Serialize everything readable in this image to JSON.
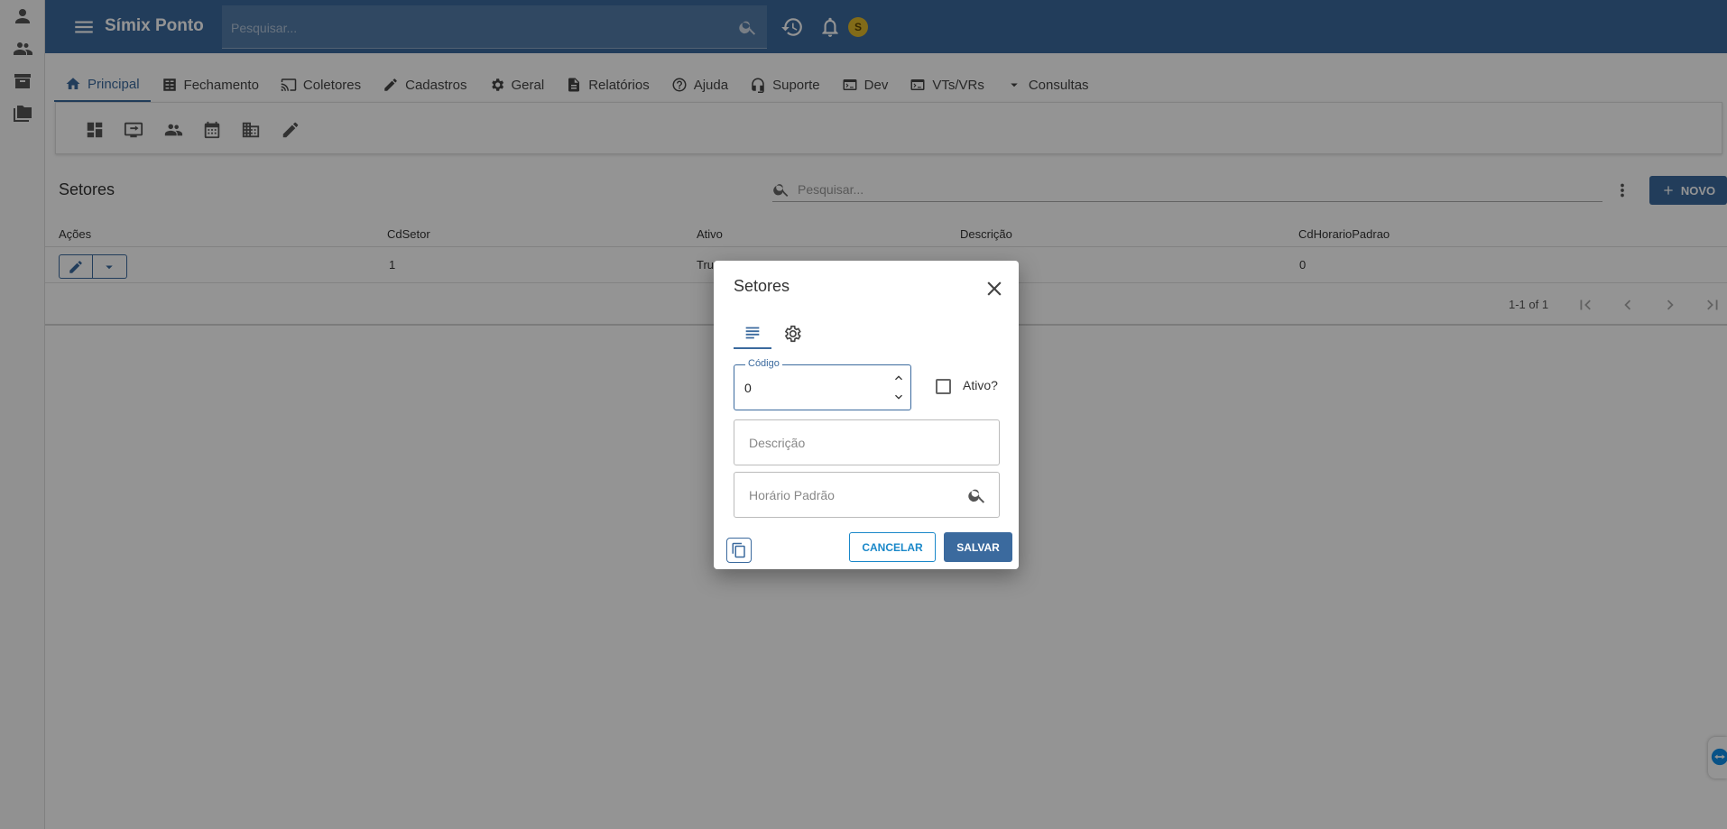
{
  "app": {
    "title": "Símix Ponto",
    "search_placeholder": "Pesquisar...",
    "avatar_initial": "S"
  },
  "nav_tabs": [
    {
      "label": "Principal",
      "icon": "home-icon",
      "active": true
    },
    {
      "label": "Fechamento",
      "icon": "calculator-icon"
    },
    {
      "label": "Coletores",
      "icon": "cast-icon"
    },
    {
      "label": "Cadastros",
      "icon": "pencil-icon"
    },
    {
      "label": "Geral",
      "icon": "gear-icon"
    },
    {
      "label": "Relatórios",
      "icon": "document-icon"
    },
    {
      "label": "Ajuda",
      "icon": "help-icon"
    },
    {
      "label": "Suporte",
      "icon": "headset-icon"
    },
    {
      "label": "Dev",
      "icon": "terminal-icon"
    },
    {
      "label": "VTs/VRs",
      "icon": "terminal-icon"
    },
    {
      "label": "Consultas",
      "icon": "caret-down-icon"
    }
  ],
  "page": {
    "title": "Setores",
    "search_placeholder": "Pesquisar...",
    "new_label": "NOVO"
  },
  "grid": {
    "columns": [
      "Ações",
      "CdSetor",
      "Ativo",
      "Descrição",
      "CdHorarioPadrao"
    ],
    "rows": [
      {
        "cdsetor": "1",
        "ativo": "Tru",
        "descricao": "",
        "cdhorariopadrao": "0"
      }
    ],
    "pager_text": "1-1 of 1"
  },
  "dialog": {
    "title": "Setores",
    "codigo_label": "Código",
    "codigo_value": "0",
    "ativo_label": "Ativo?",
    "descricao_placeholder": "Descrição",
    "horario_placeholder": "Horário Padrão",
    "cancel_label": "CANCELAR",
    "save_label": "SALVAR"
  },
  "colors": {
    "primary": "#3b6a9e",
    "cancel": "#1a88c9",
    "avatar": "#e0b82a"
  }
}
